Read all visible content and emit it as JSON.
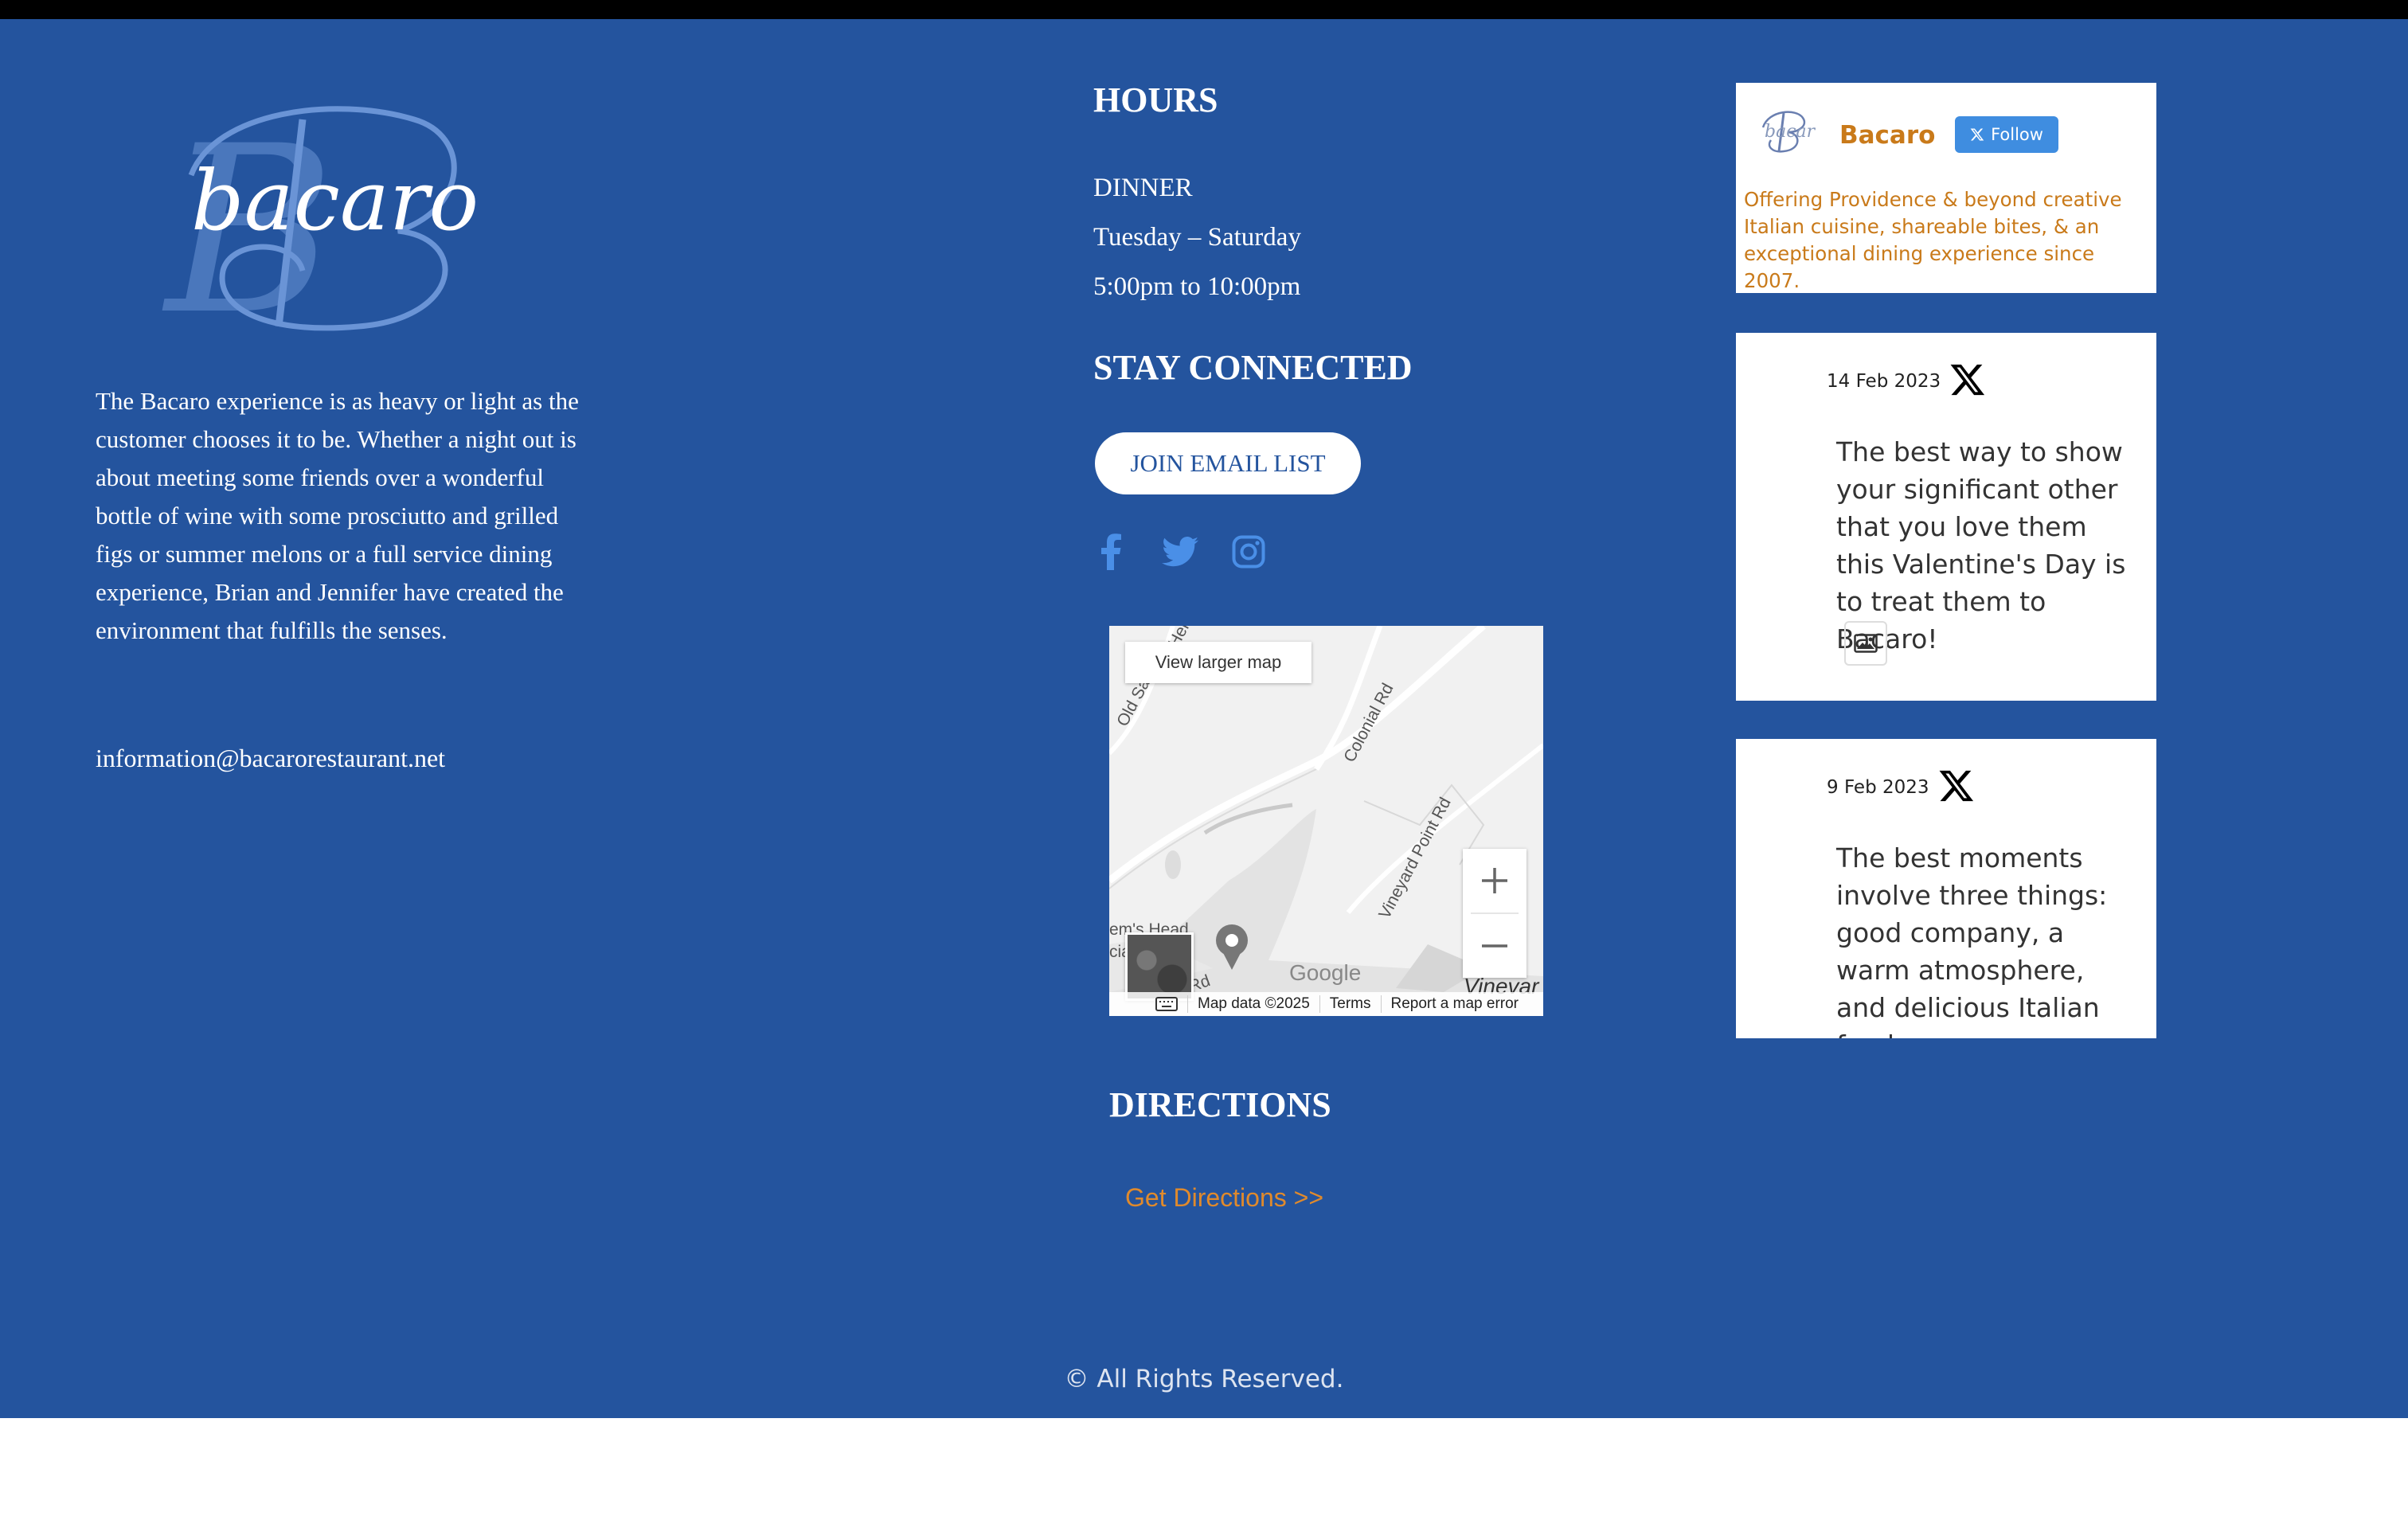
{
  "brand": {
    "logo_text": "bacaro",
    "logo_monogram": "B"
  },
  "about": {
    "text": "The Bacaro experience is as heavy or light as the customer chooses it to be. Whether a night out is about meeting some friends over a wonderful bottle of wine with some prosciutto and grilled figs or summer melons or a full service dining experience, Brian and Jennifer have created the environment that fulfills the senses.",
    "email": "information@bacarorestaurant.net"
  },
  "hours": {
    "heading": "HOURS",
    "meal": "DINNER",
    "days": "Tuesday – Saturday",
    "time": "5:00pm to 10:00pm"
  },
  "connect": {
    "heading": "STAY CONNECTED",
    "join_label": "JOIN EMAIL LIST",
    "social": [
      "facebook-icon",
      "twitter-icon",
      "instagram-icon"
    ]
  },
  "map": {
    "view_larger": "View larger map",
    "google": "Google",
    "place": "Vinevar",
    "footer": [
      "Map data ©2025",
      "Terms",
      "Report a map error"
    ],
    "street_labels": [
      "Colonial Rd",
      "Vineyard Point Rd",
      "Old Sac",
      "Hel",
      "em's Head",
      "ciation Inc",
      "Rd"
    ]
  },
  "directions": {
    "heading": "DIRECTIONS",
    "link_label": "Get Directions >>"
  },
  "twitter": {
    "profile": {
      "name": "Bacaro",
      "follow_label": "Follow",
      "bio": "Offering Providence & beyond creative Italian cuisine, shareable bites, & an exceptional dining experience since 2007."
    },
    "tweets": [
      {
        "date": "14 Feb 2023",
        "text": "The best way to show your significant other that you love them this Valentine's Day is to treat them to Bacaro!"
      },
      {
        "date": "9 Feb 2023",
        "text": "The best moments involve three things: good company, a warm atmosphere, and delicious Italian food."
      }
    ]
  },
  "footer": {
    "copyright": "© All Rights Reserved."
  },
  "colors": {
    "background": "#24549e",
    "accent": "#e08a2c",
    "twitter_orange": "#c97a1a",
    "follow_blue": "#3f8de0",
    "social_blue": "#4a8fe7"
  }
}
